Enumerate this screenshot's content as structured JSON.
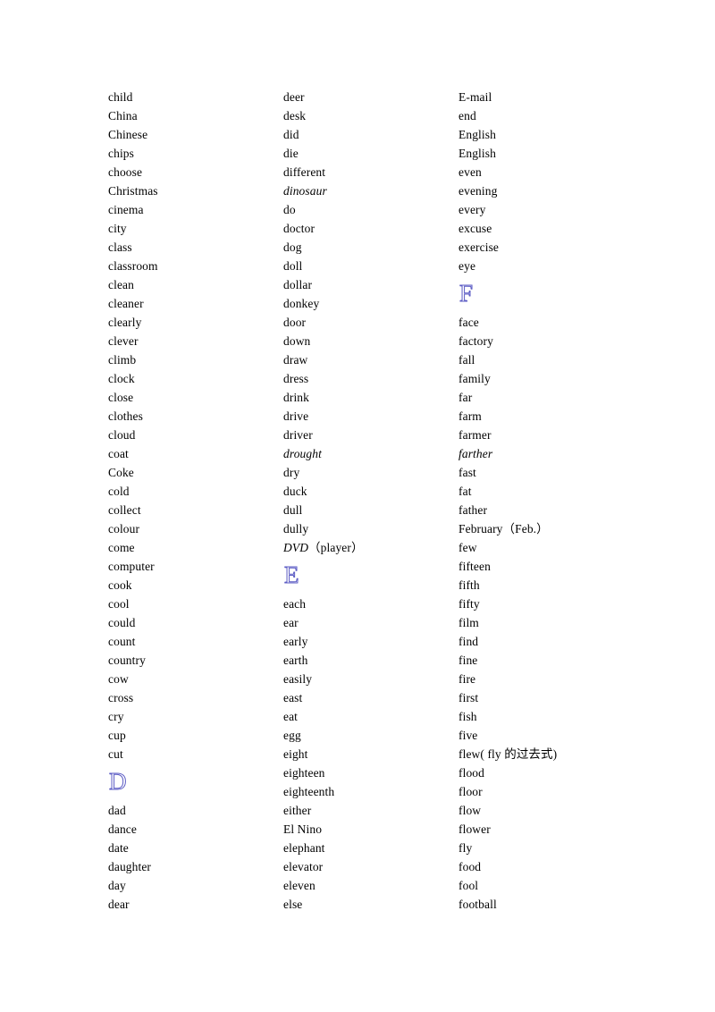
{
  "document": {
    "type": "vocabulary-word-list",
    "page_background": "#ffffff",
    "text_color": "#000000",
    "letter_heading_color": "#5b5bc4",
    "columns": [
      {
        "name": "column-1",
        "entries": [
          {
            "text": "child",
            "style": "normal"
          },
          {
            "text": "China",
            "style": "normal"
          },
          {
            "text": "Chinese",
            "style": "normal"
          },
          {
            "text": "chips",
            "style": "normal"
          },
          {
            "text": "choose",
            "style": "normal"
          },
          {
            "text": "Christmas",
            "style": "normal"
          },
          {
            "text": "cinema",
            "style": "normal"
          },
          {
            "text": "city",
            "style": "normal"
          },
          {
            "text": "class",
            "style": "normal"
          },
          {
            "text": "classroom",
            "style": "normal"
          },
          {
            "text": "clean",
            "style": "normal"
          },
          {
            "text": "cleaner",
            "style": "normal"
          },
          {
            "text": "clearly",
            "style": "normal"
          },
          {
            "text": "clever",
            "style": "normal"
          },
          {
            "text": "climb",
            "style": "normal"
          },
          {
            "text": "clock",
            "style": "normal"
          },
          {
            "text": "close",
            "style": "normal"
          },
          {
            "text": "clothes",
            "style": "normal"
          },
          {
            "text": "cloud",
            "style": "normal"
          },
          {
            "text": "coat",
            "style": "normal"
          },
          {
            "text": "Coke",
            "style": "normal"
          },
          {
            "text": "cold",
            "style": "normal"
          },
          {
            "text": "collect",
            "style": "normal"
          },
          {
            "text": "colour",
            "style": "normal"
          },
          {
            "text": "come",
            "style": "normal"
          },
          {
            "text": "computer",
            "style": "normal"
          },
          {
            "text": "cook",
            "style": "normal"
          },
          {
            "text": "cool",
            "style": "normal"
          },
          {
            "text": "could",
            "style": "normal"
          },
          {
            "text": "count",
            "style": "normal"
          },
          {
            "text": "country",
            "style": "normal"
          },
          {
            "text": "cow",
            "style": "normal"
          },
          {
            "text": "cross",
            "style": "normal"
          },
          {
            "text": "cry",
            "style": "normal"
          },
          {
            "text": "cup",
            "style": "normal"
          },
          {
            "text": "cut",
            "style": "normal"
          },
          {
            "text": "D",
            "style": "letter-heading"
          },
          {
            "text": "dad",
            "style": "normal"
          },
          {
            "text": "dance",
            "style": "normal"
          },
          {
            "text": "date",
            "style": "normal"
          },
          {
            "text": "daughter",
            "style": "normal"
          },
          {
            "text": "day",
            "style": "normal"
          },
          {
            "text": "dear",
            "style": "normal"
          }
        ]
      },
      {
        "name": "column-2",
        "entries": [
          {
            "text": "deer",
            "style": "normal"
          },
          {
            "text": "desk",
            "style": "normal"
          },
          {
            "text": "did",
            "style": "normal"
          },
          {
            "text": "die",
            "style": "normal"
          },
          {
            "text": "different",
            "style": "normal"
          },
          {
            "text": "dinosaur",
            "style": "italic"
          },
          {
            "text": "do",
            "style": "normal"
          },
          {
            "text": "doctor",
            "style": "normal"
          },
          {
            "text": "dog",
            "style": "normal"
          },
          {
            "text": "doll",
            "style": "normal"
          },
          {
            "text": "dollar",
            "style": "normal"
          },
          {
            "text": "donkey",
            "style": "normal"
          },
          {
            "text": "door",
            "style": "normal"
          },
          {
            "text": "down",
            "style": "normal"
          },
          {
            "text": "draw",
            "style": "normal"
          },
          {
            "text": "dress",
            "style": "normal"
          },
          {
            "text": "drink",
            "style": "normal"
          },
          {
            "text": "drive",
            "style": "normal"
          },
          {
            "text": "driver",
            "style": "normal"
          },
          {
            "text": "drought",
            "style": "italic"
          },
          {
            "text": "dry",
            "style": "normal"
          },
          {
            "text": "duck",
            "style": "normal"
          },
          {
            "text": "dull",
            "style": "normal"
          },
          {
            "text": "dully",
            "style": "normal"
          },
          {
            "text": "DVD（player）",
            "style": "italic-prefix"
          },
          {
            "text": "E",
            "style": "letter-heading"
          },
          {
            "text": "each",
            "style": "normal"
          },
          {
            "text": "ear",
            "style": "normal"
          },
          {
            "text": "early",
            "style": "normal"
          },
          {
            "text": "earth",
            "style": "normal"
          },
          {
            "text": "easily",
            "style": "normal"
          },
          {
            "text": "east",
            "style": "normal"
          },
          {
            "text": "eat",
            "style": "normal"
          },
          {
            "text": "egg",
            "style": "normal"
          },
          {
            "text": "eight",
            "style": "normal"
          },
          {
            "text": "eighteen",
            "style": "normal"
          },
          {
            "text": "eighteenth",
            "style": "normal"
          },
          {
            "text": "either",
            "style": "normal"
          },
          {
            "text": "El Nino",
            "style": "normal"
          },
          {
            "text": "elephant",
            "style": "normal"
          },
          {
            "text": "elevator",
            "style": "normal"
          },
          {
            "text": "eleven",
            "style": "normal"
          },
          {
            "text": "else",
            "style": "normal"
          }
        ]
      },
      {
        "name": "column-3",
        "entries": [
          {
            "text": "E-mail",
            "style": "normal"
          },
          {
            "text": "end",
            "style": "normal"
          },
          {
            "text": "English",
            "style": "normal"
          },
          {
            "text": "English",
            "style": "normal"
          },
          {
            "text": "even",
            "style": "normal"
          },
          {
            "text": "evening",
            "style": "normal"
          },
          {
            "text": "every",
            "style": "normal"
          },
          {
            "text": "excuse",
            "style": "normal"
          },
          {
            "text": "exercise",
            "style": "normal"
          },
          {
            "text": "eye",
            "style": "normal"
          },
          {
            "text": "F",
            "style": "letter-heading"
          },
          {
            "text": "face",
            "style": "normal"
          },
          {
            "text": "factory",
            "style": "normal"
          },
          {
            "text": "fall",
            "style": "normal"
          },
          {
            "text": "family",
            "style": "normal"
          },
          {
            "text": "far",
            "style": "normal"
          },
          {
            "text": "farm",
            "style": "normal"
          },
          {
            "text": "farmer",
            "style": "normal"
          },
          {
            "text": "farther",
            "style": "italic"
          },
          {
            "text": "fast",
            "style": "normal"
          },
          {
            "text": "fat",
            "style": "normal"
          },
          {
            "text": "father",
            "style": "normal"
          },
          {
            "text": "February（Feb.）",
            "style": "normal"
          },
          {
            "text": "few",
            "style": "normal"
          },
          {
            "text": "fifteen",
            "style": "normal"
          },
          {
            "text": "fifth",
            "style": "normal"
          },
          {
            "text": "fifty",
            "style": "normal"
          },
          {
            "text": "film",
            "style": "normal"
          },
          {
            "text": "find",
            "style": "normal"
          },
          {
            "text": "fine",
            "style": "normal"
          },
          {
            "text": "fire",
            "style": "normal"
          },
          {
            "text": "first",
            "style": "normal"
          },
          {
            "text": "fish",
            "style": "normal"
          },
          {
            "text": "five",
            "style": "normal"
          },
          {
            "text": "flew( fly 的过去式)",
            "style": "normal"
          },
          {
            "text": "flood",
            "style": "normal"
          },
          {
            "text": "floor",
            "style": "normal"
          },
          {
            "text": "flow",
            "style": "normal"
          },
          {
            "text": "flower",
            "style": "normal"
          },
          {
            "text": "fly",
            "style": "normal"
          },
          {
            "text": "food",
            "style": "normal"
          },
          {
            "text": "fool",
            "style": "normal"
          },
          {
            "text": "football",
            "style": "normal"
          }
        ]
      }
    ]
  }
}
